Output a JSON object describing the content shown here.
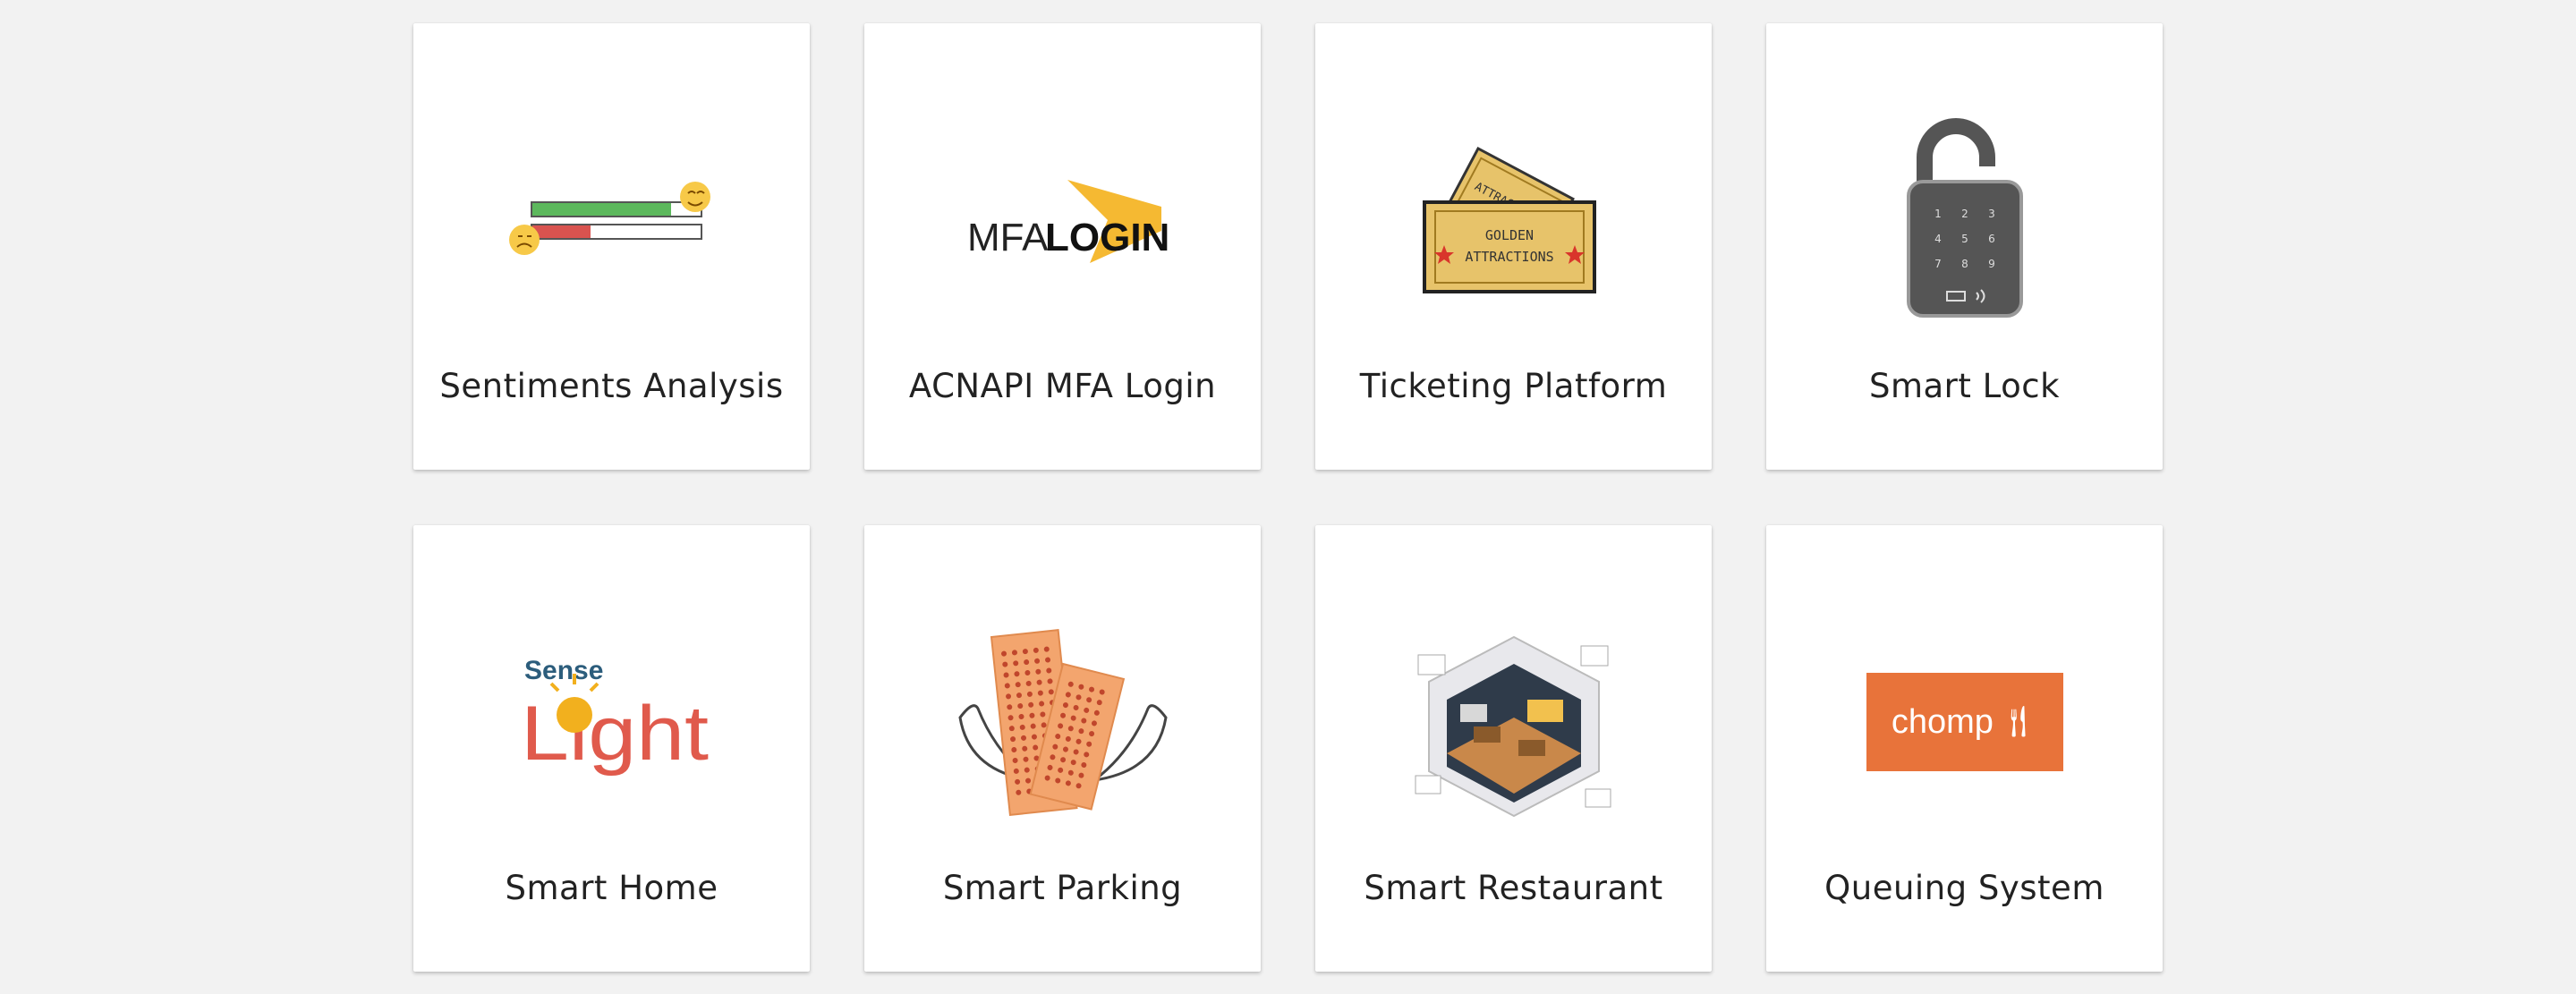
{
  "cards": [
    {
      "label": "Sentiments Analysis",
      "icon": "sentiment-bars-icon"
    },
    {
      "label": "ACNAPI MFA Login",
      "icon": "mfa-login-logo",
      "logo_text_mfa": "MFA",
      "logo_text_login": "LOGIN"
    },
    {
      "label": "Ticketing Platform",
      "icon": "golden-tickets-icon",
      "ticket_line1": "GOLDEN",
      "ticket_line2": "ATTRACTIONS"
    },
    {
      "label": "Smart Lock",
      "icon": "keypad-lock-icon",
      "keypad": [
        "1",
        "2",
        "3",
        "4",
        "5",
        "6",
        "7",
        "8",
        "9"
      ]
    },
    {
      "label": "Smart Home",
      "icon": "sense-light-logo",
      "logo_top": "Sense",
      "logo_bottom": "Light"
    },
    {
      "label": "Smart Parking",
      "icon": "winged-tickets-icon"
    },
    {
      "label": "Smart Restaurant",
      "icon": "isometric-restaurant-icon"
    },
    {
      "label": "Queuing System",
      "icon": "chomp-logo",
      "logo_text": "chomp"
    }
  ],
  "colors": {
    "background": "#f2f2f2",
    "card": "#ffffff",
    "chomp_orange": "#e8733a",
    "ticket_gold": "#e7c36a",
    "mfa_yellow": "#f5b932"
  }
}
